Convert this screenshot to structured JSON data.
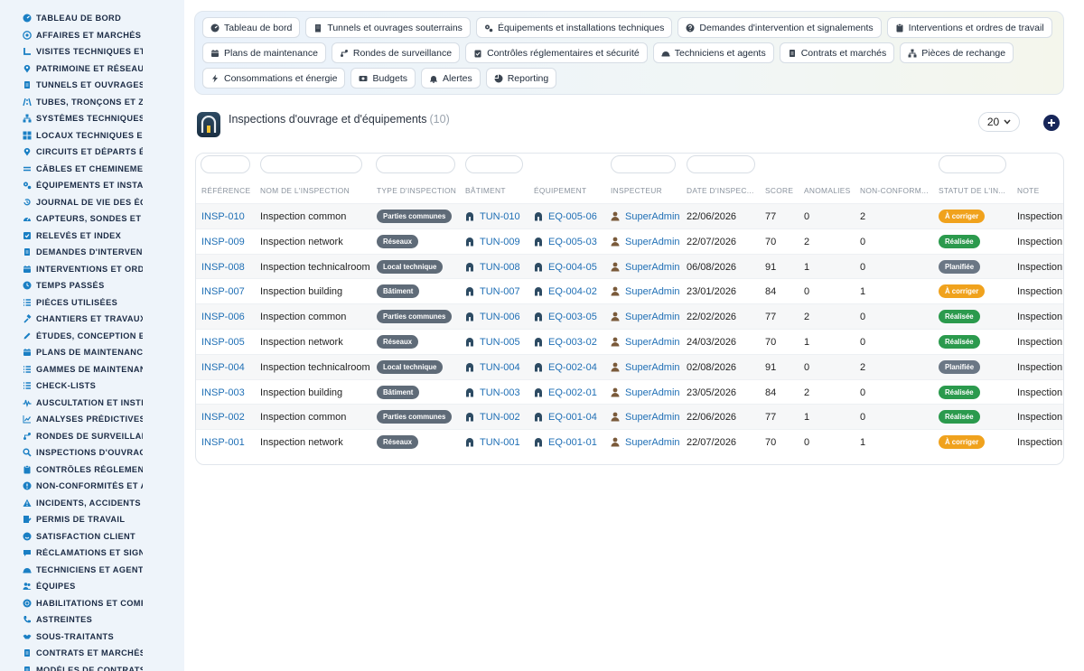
{
  "sidebar": {
    "items": [
      {
        "label": "Tableau de bord",
        "icon": "dashboard-icon"
      },
      {
        "label": "Affaires et marchés",
        "icon": "target-icon"
      },
      {
        "label": "Visites techniques et travaux",
        "icon": "walk-icon"
      },
      {
        "label": "Patrimoine et réseaux",
        "icon": "location-pin-icon"
      },
      {
        "label": "Tunnels et ouvrages",
        "icon": "document-icon"
      },
      {
        "label": "Tubes, tronçons et zones",
        "icon": "road-icon"
      },
      {
        "label": "Systèmes techniques",
        "icon": "hierarchy-icon"
      },
      {
        "label": "Locaux techniques et salles",
        "icon": "grid-icon"
      },
      {
        "label": "Circuits et départs électriques",
        "icon": "location-pin-icon"
      },
      {
        "label": "Câbles et cheminements",
        "icon": "lines-icon"
      },
      {
        "label": "Équipements et installations",
        "icon": "gears-icon"
      },
      {
        "label": "Journal de vie des équipements",
        "icon": "history-icon"
      },
      {
        "label": "Capteurs, sondes et compteurs",
        "icon": "gauge-icon"
      },
      {
        "label": "Relevés et index",
        "icon": "check-square-icon"
      },
      {
        "label": "Demandes d'intervention",
        "icon": "document-icon"
      },
      {
        "label": "Interventions et ordres de travail",
        "icon": "calendar-icon"
      },
      {
        "label": "Temps passés",
        "icon": "clock-icon"
      },
      {
        "label": "Pièces utilisées",
        "icon": "list-icon"
      },
      {
        "label": "Chantiers et travaux",
        "icon": "hammer-icon"
      },
      {
        "label": "Études, conception et ingénierie",
        "icon": "pencil-icon"
      },
      {
        "label": "Plans de maintenance",
        "icon": "calendar-icon"
      },
      {
        "label": "Gammes de maintenance",
        "icon": "list-icon"
      },
      {
        "label": "Check-lists",
        "icon": "list-icon"
      },
      {
        "label": "Auscultation et instrumentation",
        "icon": "wave-icon"
      },
      {
        "label": "Analyses prédictives",
        "icon": "chart-line-icon"
      },
      {
        "label": "Rondes de surveillance",
        "icon": "route-icon"
      },
      {
        "label": "Inspections d'ouvrage",
        "icon": "search-icon"
      },
      {
        "label": "Contrôles réglementaires",
        "icon": "clipboard-icon"
      },
      {
        "label": "Non-conformités et actions",
        "icon": "alert-circle-icon"
      },
      {
        "label": "Incidents, accidents et événements",
        "icon": "warning-icon"
      },
      {
        "label": "Permis de travail",
        "icon": "edit-doc-icon"
      },
      {
        "label": "Satisfaction client",
        "icon": "smile-icon"
      },
      {
        "label": "Réclamations et signalements",
        "icon": "comment-icon"
      },
      {
        "label": "Techniciens et agents",
        "icon": "helmet-icon"
      },
      {
        "label": "Équipes",
        "icon": "users-icon"
      },
      {
        "label": "Habilitations et compétences",
        "icon": "badge-icon"
      },
      {
        "label": "Astreintes",
        "icon": "phone-icon"
      },
      {
        "label": "Sous-traitants",
        "icon": "handshake-icon"
      },
      {
        "label": "Contrats et marchés",
        "icon": "document-icon"
      },
      {
        "label": "Modèles de contrats",
        "icon": "document-icon"
      }
    ]
  },
  "quicklinks": [
    {
      "label": "Tableau de bord",
      "icon": "dashboard-icon"
    },
    {
      "label": "Tunnels et ouvrages souterrains",
      "icon": "building-icon"
    },
    {
      "label": "Équipements et installations techniques",
      "icon": "gears-icon"
    },
    {
      "label": "Demandes d'intervention et signalements",
      "icon": "question-icon"
    },
    {
      "label": "Interventions et ordres de travail",
      "icon": "clipboard-icon"
    },
    {
      "label": "Plans de maintenance",
      "icon": "calendar-icon"
    },
    {
      "label": "Rondes de surveillance",
      "icon": "route-icon"
    },
    {
      "label": "Contrôles réglementaires et sécurité",
      "icon": "clipboard-check-icon"
    },
    {
      "label": "Techniciens et agents",
      "icon": "helmet-icon"
    },
    {
      "label": "Contrats et marchés",
      "icon": "document-icon"
    },
    {
      "label": "Pièces de rechange",
      "icon": "hierarchy-icon"
    },
    {
      "label": "Consommations et énergie",
      "icon": "bolt-icon"
    },
    {
      "label": "Budgets",
      "icon": "money-icon"
    },
    {
      "label": "Alertes",
      "icon": "bell-icon"
    },
    {
      "label": "Reporting",
      "icon": "pie-chart-icon"
    }
  ],
  "header": {
    "title": "Inspections d'ouvrage et d'équipements",
    "count": "(10)",
    "page_size": "20"
  },
  "table": {
    "columns": [
      "Référence",
      "Nom de l'inspection",
      "Type d'inspection",
      "Bâtiment",
      "Équipement",
      "Inspecteur",
      "Date d'inspec...",
      "Score",
      "Anomalies",
      "Non-conform...",
      "Statut de l'in...",
      "Note"
    ],
    "rows": [
      {
        "ref": "INSP-010",
        "name": "Inspection common",
        "type": "Parties communes",
        "building": "TUN-010",
        "equipment": "EQ-005-06",
        "inspector": "SuperAdmin",
        "date": "22/06/2026",
        "score": "77",
        "anomalies": "0",
        "nonconf": "2",
        "status": "À corriger",
        "status_color": "#f0a21d",
        "note": "Inspection"
      },
      {
        "ref": "INSP-009",
        "name": "Inspection network",
        "type": "Réseaux",
        "building": "TUN-009",
        "equipment": "EQ-005-03",
        "inspector": "SuperAdmin",
        "date": "22/07/2026",
        "score": "70",
        "anomalies": "2",
        "nonconf": "0",
        "status": "Réalisée",
        "status_color": "#2b9a4d",
        "note": "Inspection"
      },
      {
        "ref": "INSP-008",
        "name": "Inspection technicalroom",
        "type": "Local technique",
        "building": "TUN-008",
        "equipment": "EQ-004-05",
        "inspector": "SuperAdmin",
        "date": "06/08/2026",
        "score": "91",
        "anomalies": "1",
        "nonconf": "0",
        "status": "Planifiée",
        "status_color": "#6b7785",
        "note": "Inspection"
      },
      {
        "ref": "INSP-007",
        "name": "Inspection building",
        "type": "Bâtiment",
        "building": "TUN-007",
        "equipment": "EQ-004-02",
        "inspector": "SuperAdmin",
        "date": "23/01/2026",
        "score": "84",
        "anomalies": "0",
        "nonconf": "1",
        "status": "À corriger",
        "status_color": "#f0a21d",
        "note": "Inspection"
      },
      {
        "ref": "INSP-006",
        "name": "Inspection common",
        "type": "Parties communes",
        "building": "TUN-006",
        "equipment": "EQ-003-05",
        "inspector": "SuperAdmin",
        "date": "22/02/2026",
        "score": "77",
        "anomalies": "2",
        "nonconf": "0",
        "status": "Réalisée",
        "status_color": "#2b9a4d",
        "note": "Inspection"
      },
      {
        "ref": "INSP-005",
        "name": "Inspection network",
        "type": "Réseaux",
        "building": "TUN-005",
        "equipment": "EQ-003-02",
        "inspector": "SuperAdmin",
        "date": "24/03/2026",
        "score": "70",
        "anomalies": "1",
        "nonconf": "0",
        "status": "Réalisée",
        "status_color": "#2b9a4d",
        "note": "Inspection"
      },
      {
        "ref": "INSP-004",
        "name": "Inspection technicalroom",
        "type": "Local technique",
        "building": "TUN-004",
        "equipment": "EQ-002-04",
        "inspector": "SuperAdmin",
        "date": "02/08/2026",
        "score": "91",
        "anomalies": "0",
        "nonconf": "2",
        "status": "Planifiée",
        "status_color": "#6b7785",
        "note": "Inspection"
      },
      {
        "ref": "INSP-003",
        "name": "Inspection building",
        "type": "Bâtiment",
        "building": "TUN-003",
        "equipment": "EQ-002-01",
        "inspector": "SuperAdmin",
        "date": "23/05/2026",
        "score": "84",
        "anomalies": "2",
        "nonconf": "0",
        "status": "Réalisée",
        "status_color": "#2b9a4d",
        "note": "Inspection"
      },
      {
        "ref": "INSP-002",
        "name": "Inspection common",
        "type": "Parties communes",
        "building": "TUN-002",
        "equipment": "EQ-001-04",
        "inspector": "SuperAdmin",
        "date": "22/06/2026",
        "score": "77",
        "anomalies": "1",
        "nonconf": "0",
        "status": "Réalisée",
        "status_color": "#2b9a4d",
        "note": "Inspection"
      },
      {
        "ref": "INSP-001",
        "name": "Inspection network",
        "type": "Réseaux",
        "building": "TUN-001",
        "equipment": "EQ-001-01",
        "inspector": "SuperAdmin",
        "date": "22/07/2026",
        "score": "70",
        "anomalies": "0",
        "nonconf": "1",
        "status": "À corriger",
        "status_color": "#f0a21d",
        "note": "Inspection"
      }
    ]
  },
  "colors": {
    "accent": "#1f6fb5",
    "sidebar_bg": "#eef4fa",
    "icon": "#1a7fc4",
    "add_button": "#172659"
  }
}
